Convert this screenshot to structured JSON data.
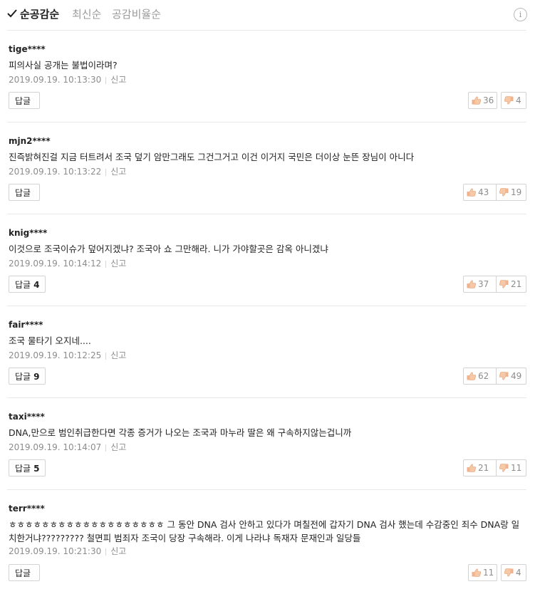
{
  "sort": {
    "options": [
      "순공감순",
      "최신순",
      "공감비율순"
    ],
    "info_label": "i"
  },
  "reply_label": "답글",
  "report_label": "신고",
  "comments": [
    {
      "author": "tige****",
      "text": "피의사실 공개는 불법이라며?",
      "date": "2019.09.19. 10:13:30",
      "replies": "",
      "likes": "36",
      "dislikes": "4"
    },
    {
      "author": "mjn2****",
      "text": "진즉밝혀진걸 지금 터트려서 조국 덮기 암만그래도 그건그거고 이건 이거지 국민은 더이상 눈뜬 장님이 아니다",
      "date": "2019.09.19. 10:13:22",
      "replies": "",
      "likes": "43",
      "dislikes": "19"
    },
    {
      "author": "knig****",
      "text": "이것으로 조국이슈가 덮어지겠냐? 조국아 쇼 그만해라. 니가 가야할곳은 감옥 아니겠냐",
      "date": "2019.09.19. 10:14:12",
      "replies": "4",
      "likes": "37",
      "dislikes": "21"
    },
    {
      "author": "fair****",
      "text": "조국 물타기 오지네....",
      "date": "2019.09.19. 10:12:25",
      "replies": "9",
      "likes": "62",
      "dislikes": "49"
    },
    {
      "author": "taxi****",
      "text": "DNA,만으로 범인취급한다면 각종 증거가 나오는 조국과 마누라 딸은 왜 구속하지않는겁니까",
      "date": "2019.09.19. 10:14:07",
      "replies": "5",
      "likes": "21",
      "dislikes": "11"
    },
    {
      "author": "terr****",
      "text": "ㅎㅎㅎㅎㅎㅎㅎㅎㅎㅎㅎㅎㅎㅎㅎㅎㅎㅎㅎ 그 동안 DNA 검사 안하고 있다가 며칠전에 갑자기 DNA 검사 했는데 수감중인 죄수 DNA랑 일치한거냐????????? 철면피 범죄자 조국이 당장 구속해라. 이게 나라냐 독재자 문재인과 일당들",
      "date": "2019.09.19. 10:21:30",
      "replies": "",
      "likes": "11",
      "dislikes": "4"
    }
  ],
  "colors": {
    "accent_text": "#1e1e1e",
    "muted": "#8c8c8c",
    "border": "#d3d3d3"
  }
}
